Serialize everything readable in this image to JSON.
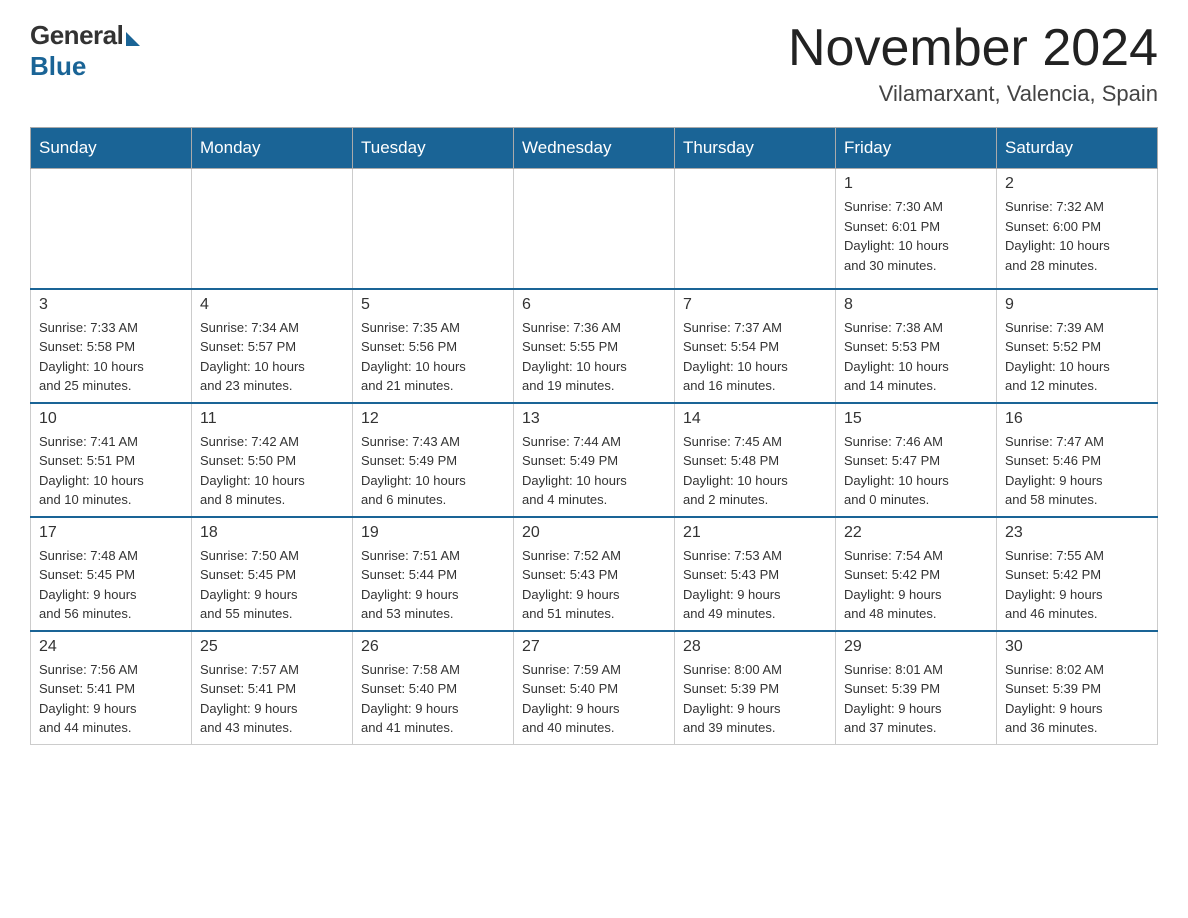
{
  "logo": {
    "general": "General",
    "blue": "Blue"
  },
  "header": {
    "month": "November 2024",
    "location": "Vilamarxant, Valencia, Spain"
  },
  "weekdays": [
    "Sunday",
    "Monday",
    "Tuesday",
    "Wednesday",
    "Thursday",
    "Friday",
    "Saturday"
  ],
  "weeks": [
    [
      {
        "day": "",
        "info": ""
      },
      {
        "day": "",
        "info": ""
      },
      {
        "day": "",
        "info": ""
      },
      {
        "day": "",
        "info": ""
      },
      {
        "day": "",
        "info": ""
      },
      {
        "day": "1",
        "info": "Sunrise: 7:30 AM\nSunset: 6:01 PM\nDaylight: 10 hours\nand 30 minutes."
      },
      {
        "day": "2",
        "info": "Sunrise: 7:32 AM\nSunset: 6:00 PM\nDaylight: 10 hours\nand 28 minutes."
      }
    ],
    [
      {
        "day": "3",
        "info": "Sunrise: 7:33 AM\nSunset: 5:58 PM\nDaylight: 10 hours\nand 25 minutes."
      },
      {
        "day": "4",
        "info": "Sunrise: 7:34 AM\nSunset: 5:57 PM\nDaylight: 10 hours\nand 23 minutes."
      },
      {
        "day": "5",
        "info": "Sunrise: 7:35 AM\nSunset: 5:56 PM\nDaylight: 10 hours\nand 21 minutes."
      },
      {
        "day": "6",
        "info": "Sunrise: 7:36 AM\nSunset: 5:55 PM\nDaylight: 10 hours\nand 19 minutes."
      },
      {
        "day": "7",
        "info": "Sunrise: 7:37 AM\nSunset: 5:54 PM\nDaylight: 10 hours\nand 16 minutes."
      },
      {
        "day": "8",
        "info": "Sunrise: 7:38 AM\nSunset: 5:53 PM\nDaylight: 10 hours\nand 14 minutes."
      },
      {
        "day": "9",
        "info": "Sunrise: 7:39 AM\nSunset: 5:52 PM\nDaylight: 10 hours\nand 12 minutes."
      }
    ],
    [
      {
        "day": "10",
        "info": "Sunrise: 7:41 AM\nSunset: 5:51 PM\nDaylight: 10 hours\nand 10 minutes."
      },
      {
        "day": "11",
        "info": "Sunrise: 7:42 AM\nSunset: 5:50 PM\nDaylight: 10 hours\nand 8 minutes."
      },
      {
        "day": "12",
        "info": "Sunrise: 7:43 AM\nSunset: 5:49 PM\nDaylight: 10 hours\nand 6 minutes."
      },
      {
        "day": "13",
        "info": "Sunrise: 7:44 AM\nSunset: 5:49 PM\nDaylight: 10 hours\nand 4 minutes."
      },
      {
        "day": "14",
        "info": "Sunrise: 7:45 AM\nSunset: 5:48 PM\nDaylight: 10 hours\nand 2 minutes."
      },
      {
        "day": "15",
        "info": "Sunrise: 7:46 AM\nSunset: 5:47 PM\nDaylight: 10 hours\nand 0 minutes."
      },
      {
        "day": "16",
        "info": "Sunrise: 7:47 AM\nSunset: 5:46 PM\nDaylight: 9 hours\nand 58 minutes."
      }
    ],
    [
      {
        "day": "17",
        "info": "Sunrise: 7:48 AM\nSunset: 5:45 PM\nDaylight: 9 hours\nand 56 minutes."
      },
      {
        "day": "18",
        "info": "Sunrise: 7:50 AM\nSunset: 5:45 PM\nDaylight: 9 hours\nand 55 minutes."
      },
      {
        "day": "19",
        "info": "Sunrise: 7:51 AM\nSunset: 5:44 PM\nDaylight: 9 hours\nand 53 minutes."
      },
      {
        "day": "20",
        "info": "Sunrise: 7:52 AM\nSunset: 5:43 PM\nDaylight: 9 hours\nand 51 minutes."
      },
      {
        "day": "21",
        "info": "Sunrise: 7:53 AM\nSunset: 5:43 PM\nDaylight: 9 hours\nand 49 minutes."
      },
      {
        "day": "22",
        "info": "Sunrise: 7:54 AM\nSunset: 5:42 PM\nDaylight: 9 hours\nand 48 minutes."
      },
      {
        "day": "23",
        "info": "Sunrise: 7:55 AM\nSunset: 5:42 PM\nDaylight: 9 hours\nand 46 minutes."
      }
    ],
    [
      {
        "day": "24",
        "info": "Sunrise: 7:56 AM\nSunset: 5:41 PM\nDaylight: 9 hours\nand 44 minutes."
      },
      {
        "day": "25",
        "info": "Sunrise: 7:57 AM\nSunset: 5:41 PM\nDaylight: 9 hours\nand 43 minutes."
      },
      {
        "day": "26",
        "info": "Sunrise: 7:58 AM\nSunset: 5:40 PM\nDaylight: 9 hours\nand 41 minutes."
      },
      {
        "day": "27",
        "info": "Sunrise: 7:59 AM\nSunset: 5:40 PM\nDaylight: 9 hours\nand 40 minutes."
      },
      {
        "day": "28",
        "info": "Sunrise: 8:00 AM\nSunset: 5:39 PM\nDaylight: 9 hours\nand 39 minutes."
      },
      {
        "day": "29",
        "info": "Sunrise: 8:01 AM\nSunset: 5:39 PM\nDaylight: 9 hours\nand 37 minutes."
      },
      {
        "day": "30",
        "info": "Sunrise: 8:02 AM\nSunset: 5:39 PM\nDaylight: 9 hours\nand 36 minutes."
      }
    ]
  ]
}
